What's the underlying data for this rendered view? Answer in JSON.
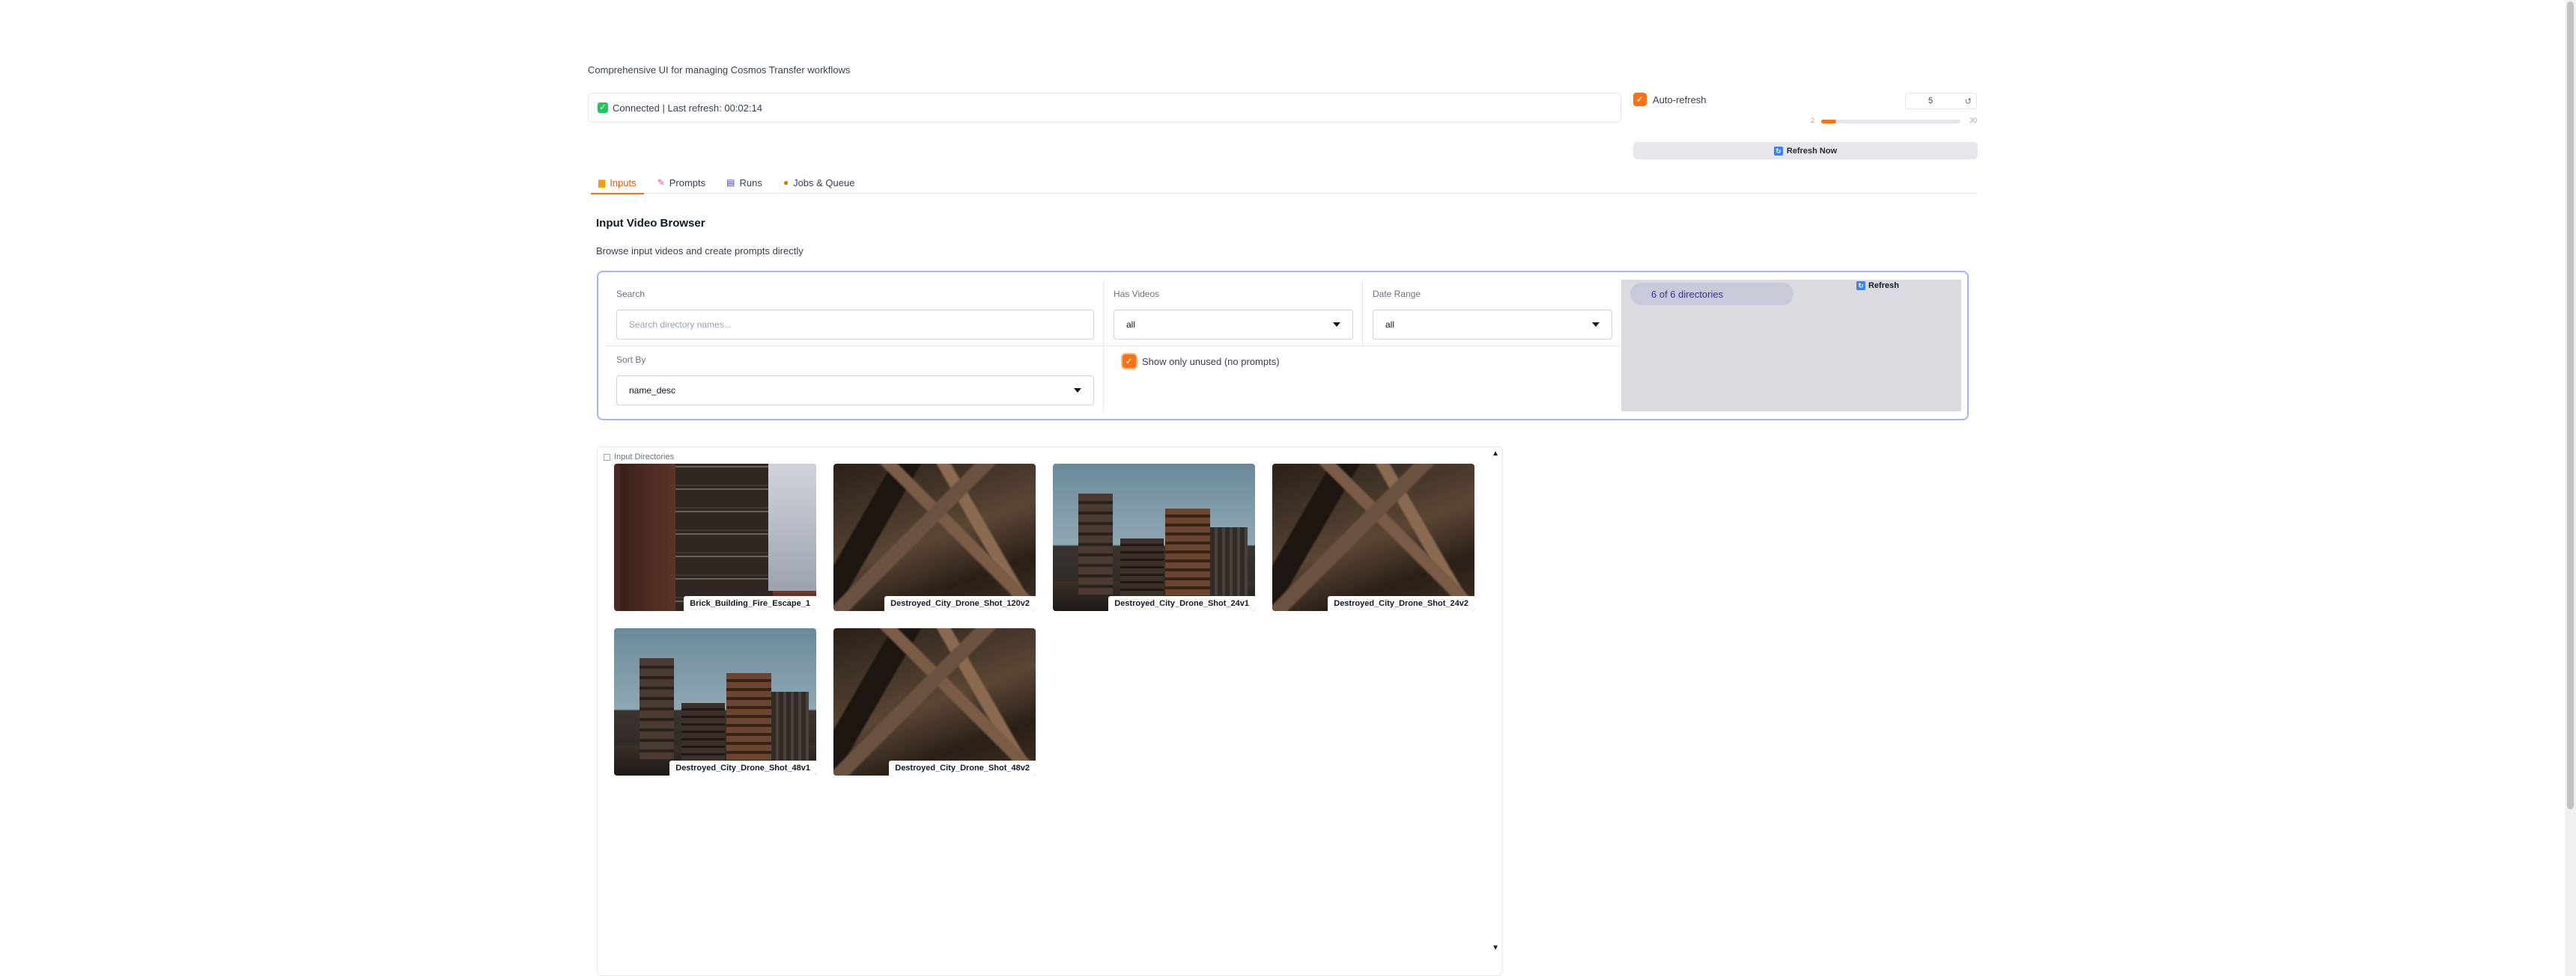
{
  "header": {
    "subtitle": "Comprehensive UI for managing Cosmos Transfer workflows"
  },
  "status": {
    "text": "Connected | Last refresh: 00:02:14"
  },
  "refresh_controls": {
    "auto_refresh_label": "Auto-refresh",
    "auto_refresh_checked": true,
    "interval_value": "5",
    "slider_min": "2",
    "slider_max": "30",
    "slider_value": 5,
    "refresh_now_label": "Refresh Now"
  },
  "tabs": [
    {
      "label": "Inputs",
      "icon": "folder-icon",
      "active": true
    },
    {
      "label": "Prompts",
      "icon": "brush-icon",
      "active": false
    },
    {
      "label": "Runs",
      "icon": "clapper-icon",
      "active": false
    },
    {
      "label": "Jobs & Queue",
      "icon": "cookie-icon",
      "active": false
    }
  ],
  "inputs_tab": {
    "title": "Input Video Browser",
    "description": "Browse input videos and create prompts directly",
    "filters": {
      "search_label": "Search",
      "search_placeholder": "Search directory names...",
      "has_videos_label": "Has Videos",
      "has_videos_value": "all",
      "date_range_label": "Date Range",
      "date_range_value": "all",
      "sort_by_label": "Sort By",
      "sort_by_value": "name_desc",
      "unused_label": "Show only unused (no prompts)",
      "unused_checked": true,
      "count_text": "6  of  6  directories",
      "refresh_label": "Refresh"
    },
    "gallery": {
      "label": "Input Directories",
      "items": [
        {
          "name": "Brick_Building_Fire_Escape_1",
          "image": "brick"
        },
        {
          "name": "Destroyed_City_Drone_Shot_120v2",
          "image": "rubble"
        },
        {
          "name": "Destroyed_City_Drone_Shot_24v1",
          "image": "city"
        },
        {
          "name": "Destroyed_City_Drone_Shot_24v2",
          "image": "rubble"
        },
        {
          "name": "Destroyed_City_Drone_Shot_48v1",
          "image": "city"
        },
        {
          "name": "Destroyed_City_Drone_Shot_48v2",
          "image": "rubble"
        }
      ]
    }
  },
  "colors": {
    "accent": "#f97316",
    "filter_border": "#a5b4fc",
    "count_pill": "#c7cad9"
  }
}
